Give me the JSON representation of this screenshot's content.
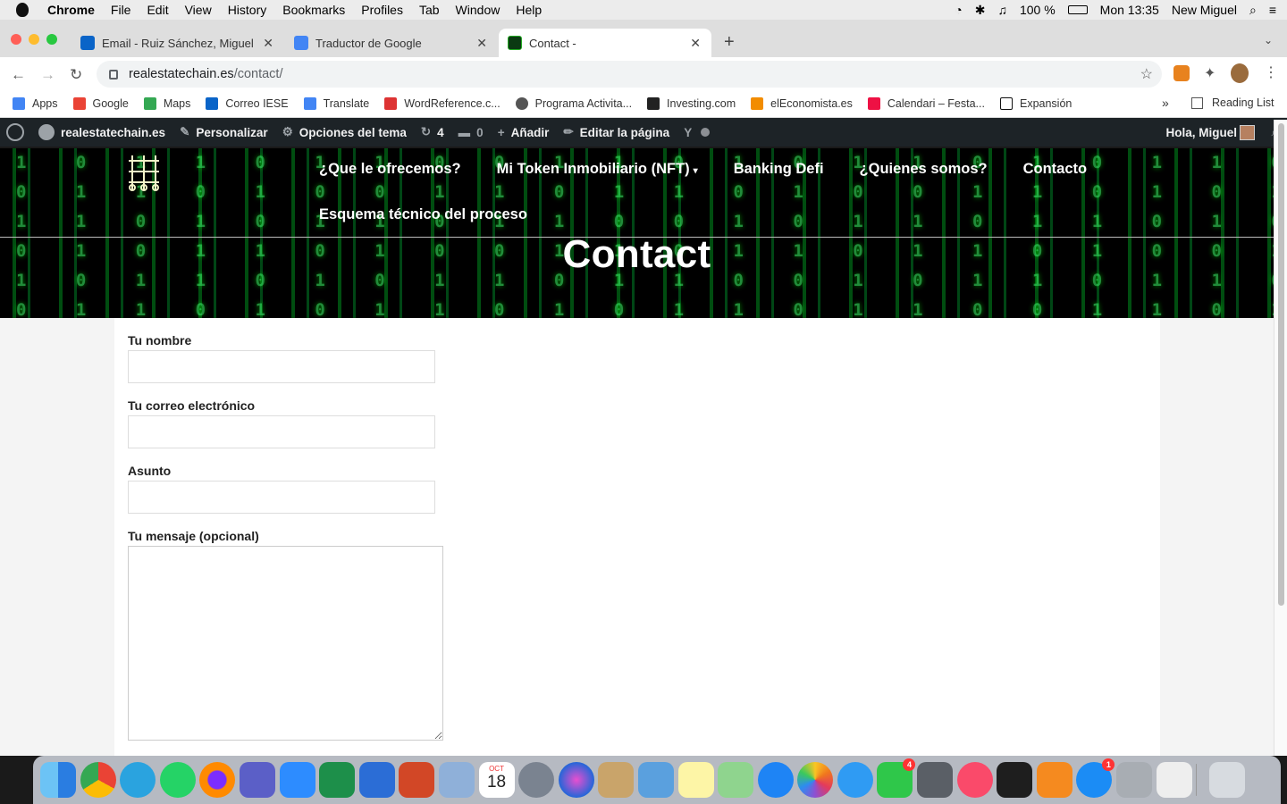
{
  "menubar": {
    "app": "Chrome",
    "items": [
      "File",
      "Edit",
      "View",
      "History",
      "Bookmarks",
      "Profiles",
      "Tab",
      "Window",
      "Help"
    ],
    "battery": "100 %",
    "clock": "Mon 13:35",
    "user": "New Miguel"
  },
  "tabs": [
    {
      "title": "Email - Ruiz Sánchez, Miguel -",
      "icon": "outlook-icon"
    },
    {
      "title": "Traductor de Google",
      "icon": "google-translate-icon"
    },
    {
      "title": "Contact -",
      "icon": "matrix-favicon"
    }
  ],
  "address": {
    "domain": "realestatechain.es",
    "path": "/contact/"
  },
  "bookmarks": [
    {
      "label": "Apps",
      "icon": "apps-grid-icon",
      "color": "#4285f4"
    },
    {
      "label": "Google",
      "icon": "google-icon",
      "color": "#ea4335"
    },
    {
      "label": "Maps",
      "icon": "maps-icon",
      "color": "#34a853"
    },
    {
      "label": "Correo IESE",
      "icon": "outlook-icon",
      "color": "#0a64c8"
    },
    {
      "label": "Translate",
      "icon": "translate-icon",
      "color": "#4285f4"
    },
    {
      "label": "WordReference.c...",
      "icon": "wordreference-icon",
      "color": "#d33"
    },
    {
      "label": "Programa Activita...",
      "icon": "programa-icon",
      "color": "#555"
    },
    {
      "label": "Investing.com",
      "icon": "investing-icon",
      "color": "#222"
    },
    {
      "label": "elEconomista.es",
      "icon": "eleconomista-icon",
      "color": "#f28c00"
    },
    {
      "label": "Calendari – Festa...",
      "icon": "calendari-icon",
      "color": "#e14"
    },
    {
      "label": "Expansión",
      "icon": "expansion-icon",
      "color": "#111"
    }
  ],
  "reading_list": "Reading List",
  "wpbar": {
    "site": "realestatechain.es",
    "personalizar": "Personalizar",
    "opciones": "Opciones del tema",
    "updates": "4",
    "comments": "0",
    "add": "Añadir",
    "edit": "Editar la página",
    "greeting": "Hola, Miguel"
  },
  "site_menu": {
    "items": [
      "¿Que le ofrecemos?",
      "Mi Token Inmobiliario (NFT)",
      "Banking Defi",
      "¿Quienes somos?",
      "Contacto"
    ],
    "second_row": "Esquema técnico del proceso"
  },
  "page_title": "Contact",
  "form": {
    "name_label": "Tu nombre",
    "email_label": "Tu correo electrónico",
    "subject_label": "Asunto",
    "message_label": "Tu mensaje (opcional)"
  },
  "dock_badges": {
    "calendar_date": "18",
    "calendar_month": "OCT",
    "facetime": "4",
    "appstore": "1"
  }
}
